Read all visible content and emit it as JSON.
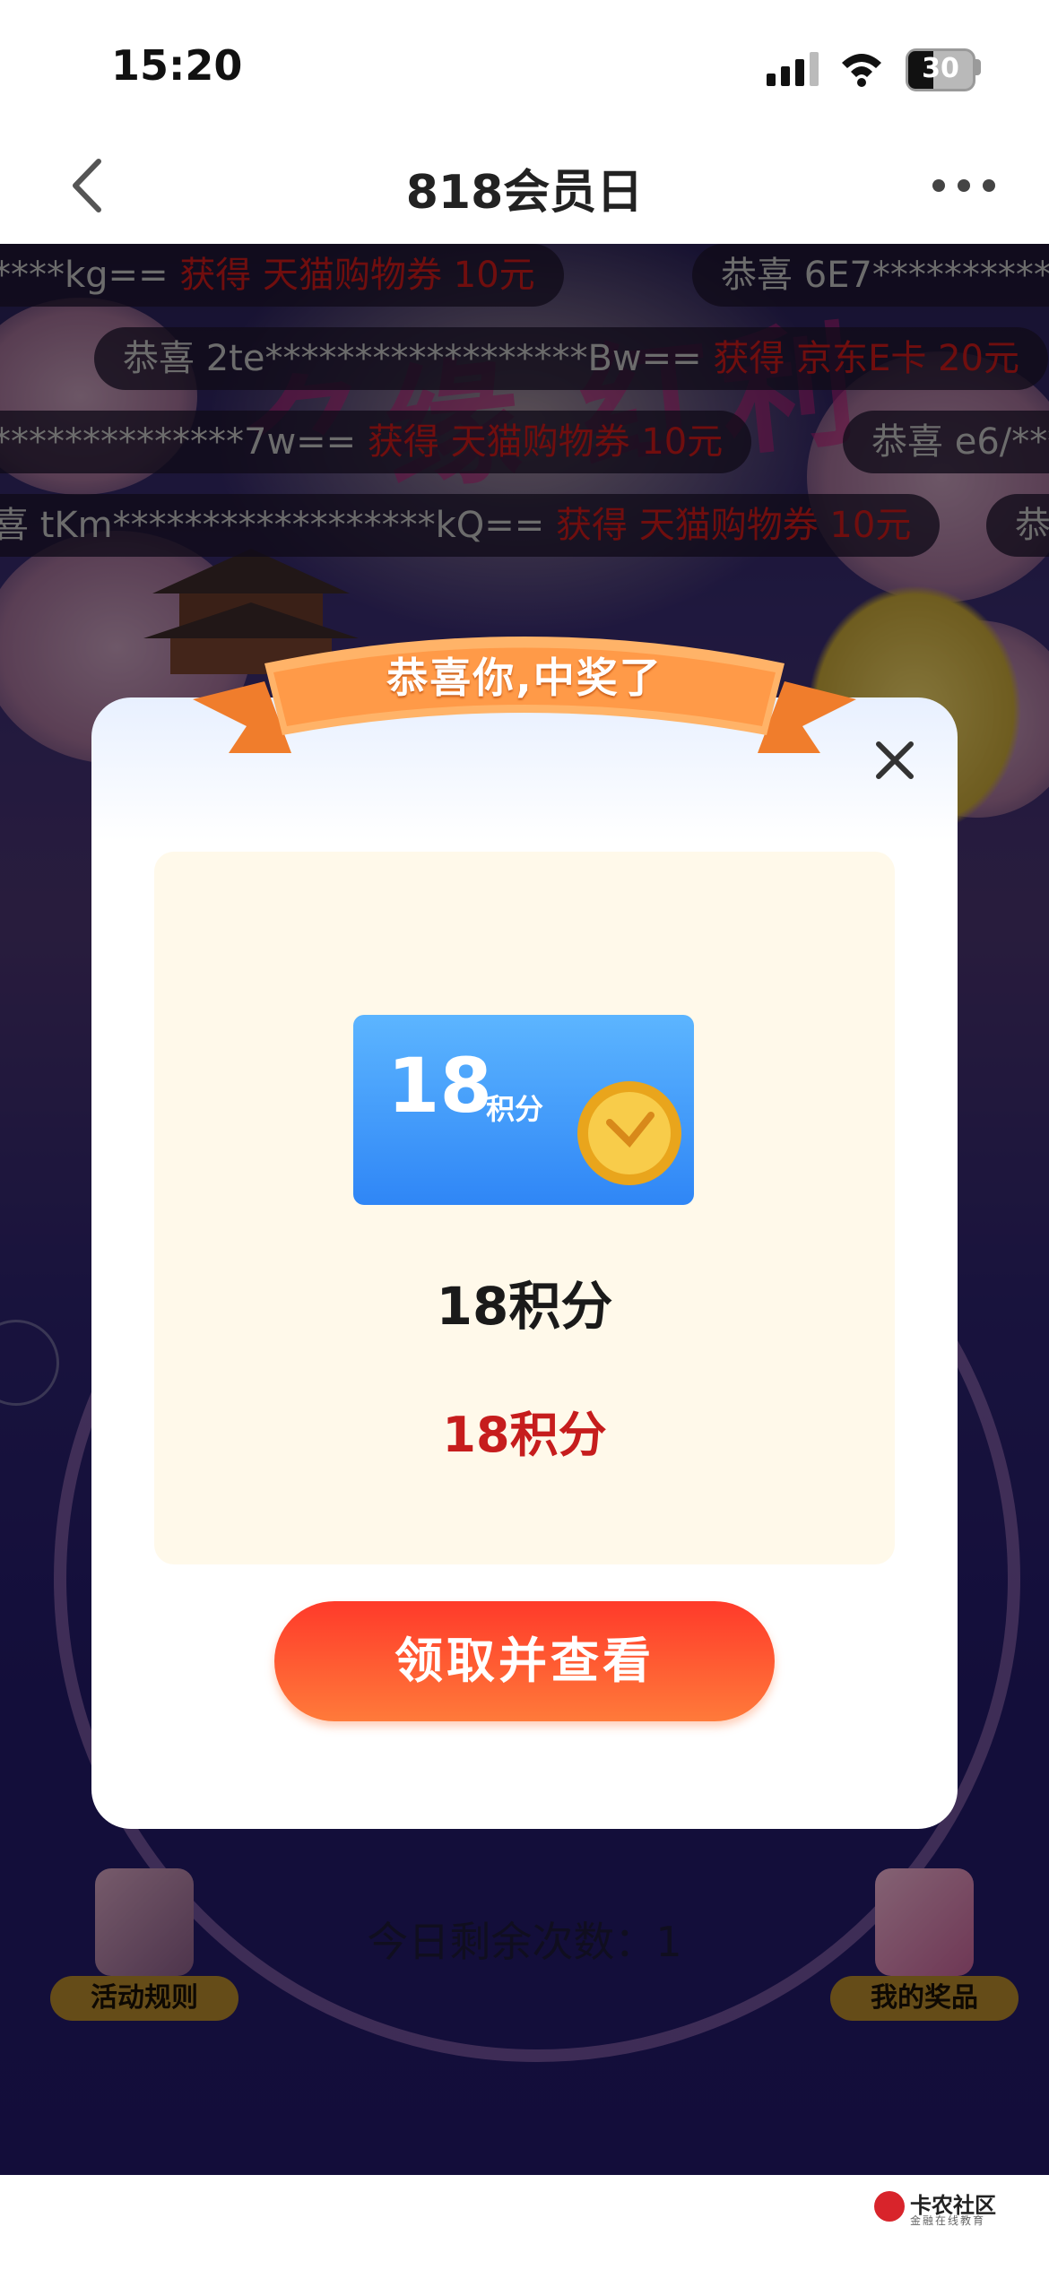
{
  "status": {
    "time": "15:20",
    "battery": "30"
  },
  "nav": {
    "title": "818会员日"
  },
  "ticker": [
    {
      "prefix": "****kg==",
      "prize": "获得 天猫购物券 10元"
    },
    {
      "prefix": "恭喜 6E7***********",
      "prize": ""
    },
    {
      "prefix": "恭喜 2te******************Bw==",
      "prize": "获得 京东E卡 20元"
    },
    {
      "prefix": "**************7w==",
      "prize": "获得 天猫购物券 10元"
    },
    {
      "prefix": "恭喜 e6/***",
      "prize": ""
    },
    {
      "prefix": "喜 tKm******************kQ==",
      "prize": "获得 天猫购物券 10元"
    },
    {
      "prefix": "恭",
      "prize": ""
    }
  ],
  "modal": {
    "banner": "恭喜你,中奖了",
    "prize_card": {
      "amount": "18",
      "unit": "积分"
    },
    "prize_name": "18积分",
    "prize_value": "18积分",
    "claim_button": "领取并查看"
  },
  "page": {
    "remaining": "今日剩余次数：1",
    "rules_button": "活动规则",
    "my_prizes_button": "我的奖品"
  },
  "watermark": {
    "name": "卡农社区",
    "sub": "金融在线教育"
  },
  "colors": {
    "accent_red": "#c61d1d",
    "button": "#ff4a2e",
    "card_blue": "#3b8df7"
  }
}
